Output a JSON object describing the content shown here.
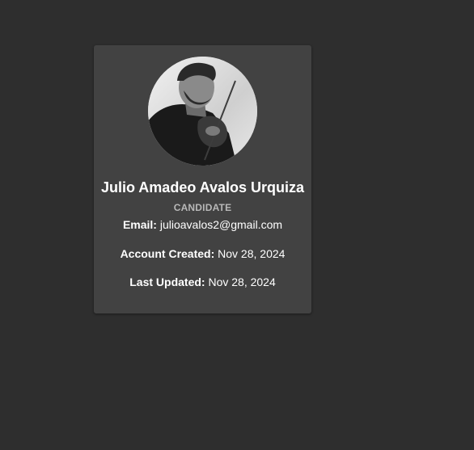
{
  "profile": {
    "name": "Julio Amadeo Avalos Urquiza",
    "role": "CANDIDATE",
    "email_label": "Email:",
    "email": "julioavalos2@gmail.com",
    "created_label": "Account Created:",
    "created": "Nov 28, 2024",
    "updated_label": "Last Updated:",
    "updated": "Nov 28, 2024"
  },
  "colors": {
    "page_background": "#2e2e2e",
    "card_background": "#424242",
    "role_text": "#b8b8b8"
  }
}
